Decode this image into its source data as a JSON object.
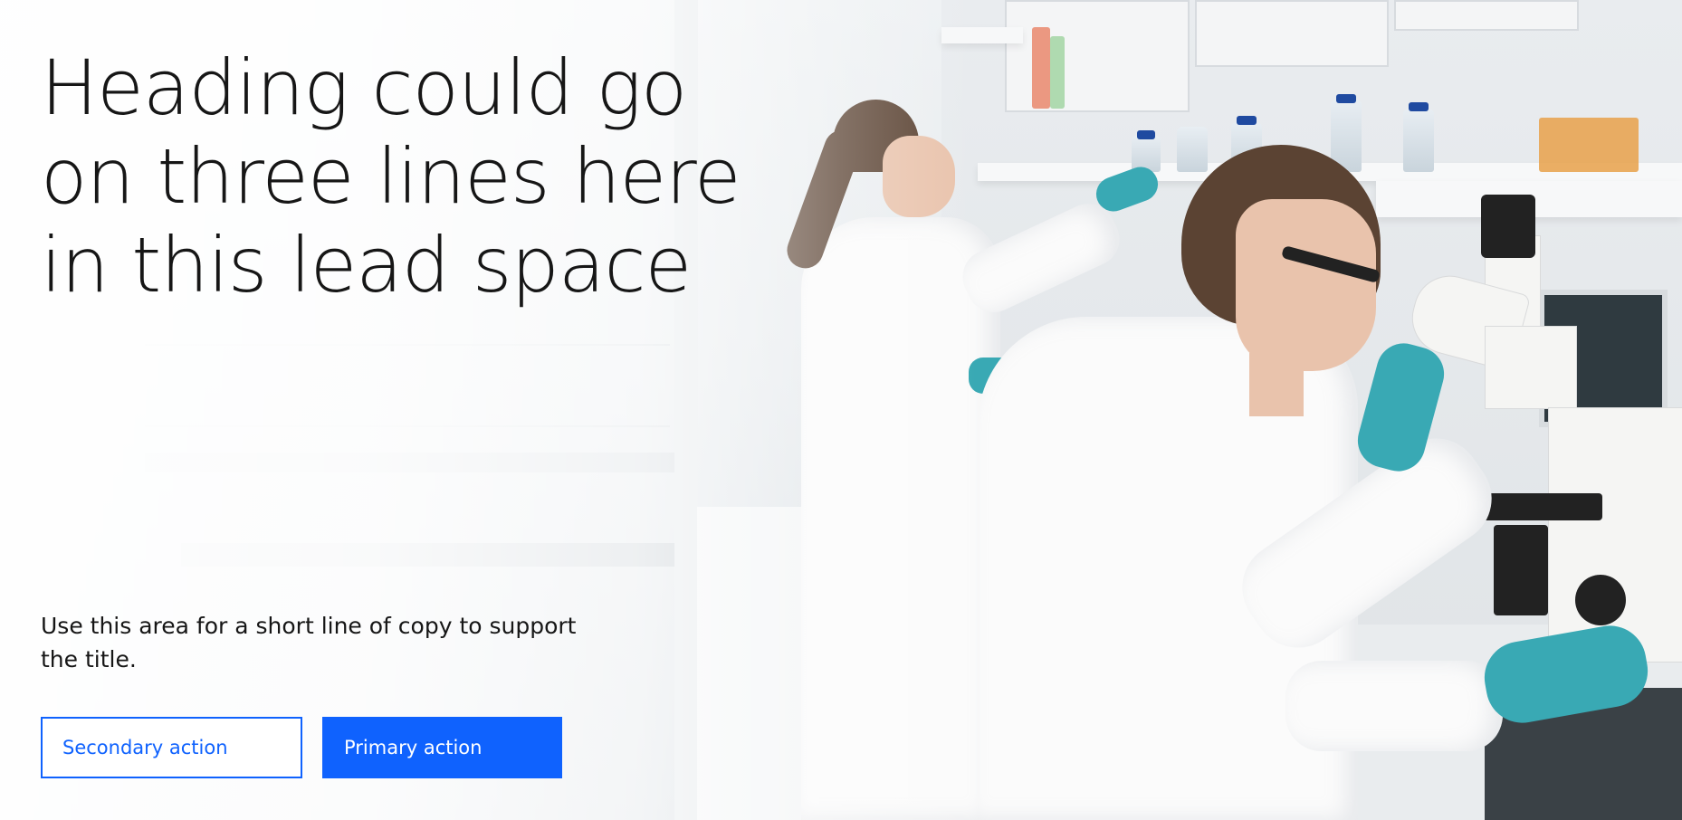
{
  "lead_space": {
    "heading": "Heading could go on three lines here in this lead space",
    "copy": "Use this area for a short line of copy to support the title.",
    "secondary_action": "Secondary action",
    "primary_action": "Primary action",
    "image_alt": "Two scientists in white lab coats working in a laboratory, one looking into a microscope"
  },
  "colors": {
    "accent": "#0f62fe",
    "text": "#161616",
    "background": "#ffffff"
  }
}
